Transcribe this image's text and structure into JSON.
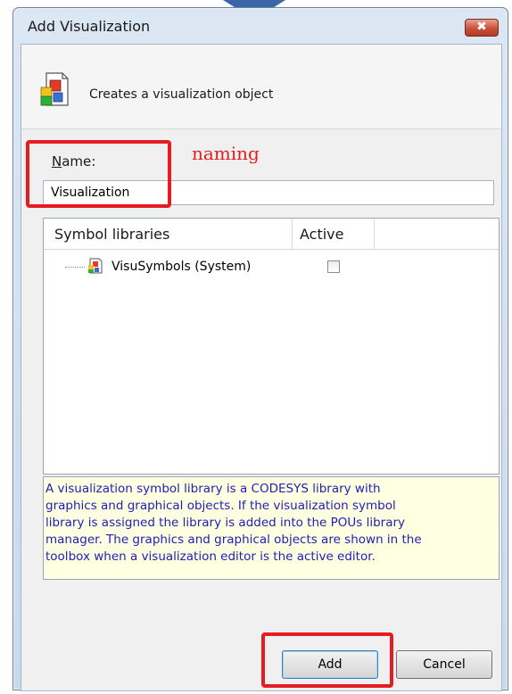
{
  "window": {
    "title": "Add Visualization",
    "close_glyph": "✖"
  },
  "header": {
    "description": "Creates a visualization object",
    "icon": "visualization-object-icon"
  },
  "form": {
    "name_label_accel": "N",
    "name_label_rest": "ame:",
    "name_value": "Visualization"
  },
  "libraries": {
    "columns": [
      "Symbol libraries",
      "Active"
    ],
    "rows": [
      {
        "name": "VisuSymbols (System)",
        "active": false,
        "icon": "library-icon"
      }
    ]
  },
  "info": {
    "lines": [
      "A visualization symbol library is a CODESYS library with",
      "graphics and graphical objects. If the visualization symbol",
      "library is assigned the library is added into the POUs library",
      "manager. The graphics and graphical objects are shown in the",
      "toolbox when a visualization editor is the active editor."
    ]
  },
  "buttons": {
    "add": "Add",
    "cancel": "Cancel"
  },
  "annotation": {
    "label": "naming",
    "color": "#e51d23"
  },
  "colors": {
    "info_background": "#ffffe1",
    "info_text": "#2020b8",
    "arrow": "#3a66a8"
  }
}
